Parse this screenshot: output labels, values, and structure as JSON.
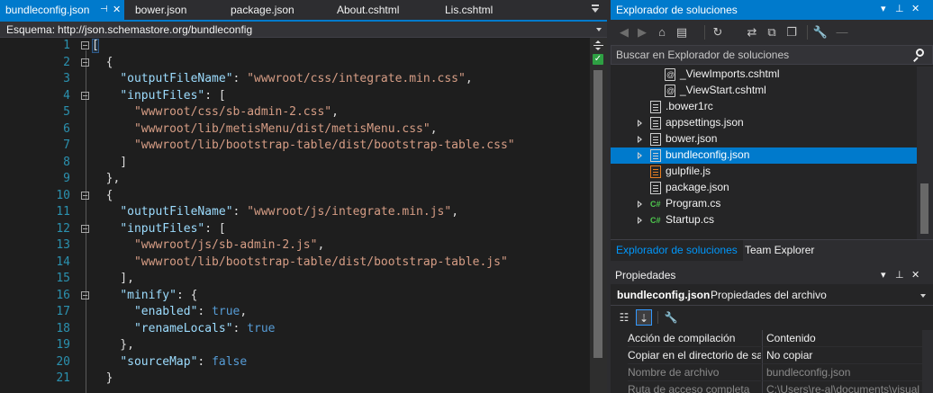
{
  "editor": {
    "tabs": [
      {
        "label": "bundleconfig.json",
        "active": true
      },
      {
        "label": "bower.json",
        "active": false
      },
      {
        "label": "package.json",
        "active": false
      },
      {
        "label": "About.cshtml",
        "active": false
      },
      {
        "label": "Lis.cshtml",
        "active": false
      }
    ],
    "pin_icon": "pin-icon",
    "close_icon": "close-icon",
    "schema_label": "Esquema:",
    "schema_value": "http://json.schemastore.org/bundleconfig",
    "lines": [
      {
        "n": "1",
        "fold": true,
        "tokens": [
          [
            "p",
            "["
          ]
        ]
      },
      {
        "n": "2",
        "fold": true,
        "tokens": [
          [
            "p",
            "  {"
          ]
        ]
      },
      {
        "n": "3",
        "fold": false,
        "tokens": [
          [
            "p",
            "    "
          ],
          [
            "k",
            "\"outputFileName\""
          ],
          [
            "p",
            ": "
          ],
          [
            "s",
            "\"wwwroot/css/integrate.min.css\""
          ],
          [
            "p",
            ","
          ]
        ]
      },
      {
        "n": "4",
        "fold": true,
        "tokens": [
          [
            "p",
            "    "
          ],
          [
            "k",
            "\"inputFiles\""
          ],
          [
            "p",
            ": ["
          ]
        ]
      },
      {
        "n": "5",
        "fold": false,
        "tokens": [
          [
            "p",
            "      "
          ],
          [
            "s",
            "\"wwwroot/css/sb-admin-2.css\""
          ],
          [
            "p",
            ","
          ]
        ]
      },
      {
        "n": "6",
        "fold": false,
        "tokens": [
          [
            "p",
            "      "
          ],
          [
            "s",
            "\"wwwroot/lib/metisMenu/dist/metisMenu.css\""
          ],
          [
            "p",
            ","
          ]
        ]
      },
      {
        "n": "7",
        "fold": false,
        "tokens": [
          [
            "p",
            "      "
          ],
          [
            "s",
            "\"wwwroot/lib/bootstrap-table/dist/bootstrap-table.css\""
          ]
        ]
      },
      {
        "n": "8",
        "fold": false,
        "tokens": [
          [
            "p",
            "    ]"
          ]
        ]
      },
      {
        "n": "9",
        "fold": false,
        "tokens": [
          [
            "p",
            "  },"
          ]
        ]
      },
      {
        "n": "10",
        "fold": true,
        "tokens": [
          [
            "p",
            "  {"
          ]
        ]
      },
      {
        "n": "11",
        "fold": false,
        "tokens": [
          [
            "p",
            "    "
          ],
          [
            "k",
            "\"outputFileName\""
          ],
          [
            "p",
            ": "
          ],
          [
            "s",
            "\"wwwroot/js/integrate.min.js\""
          ],
          [
            "p",
            ","
          ]
        ]
      },
      {
        "n": "12",
        "fold": true,
        "tokens": [
          [
            "p",
            "    "
          ],
          [
            "k",
            "\"inputFiles\""
          ],
          [
            "p",
            ": ["
          ]
        ]
      },
      {
        "n": "13",
        "fold": false,
        "tokens": [
          [
            "p",
            "      "
          ],
          [
            "s",
            "\"wwwroot/js/sb-admin-2.js\""
          ],
          [
            "p",
            ","
          ]
        ]
      },
      {
        "n": "14",
        "fold": false,
        "tokens": [
          [
            "p",
            "      "
          ],
          [
            "s",
            "\"wwwroot/lib/bootstrap-table/dist/bootstrap-table.js\""
          ]
        ]
      },
      {
        "n": "15",
        "fold": false,
        "tokens": [
          [
            "p",
            "    ],"
          ]
        ]
      },
      {
        "n": "16",
        "fold": true,
        "tokens": [
          [
            "p",
            "    "
          ],
          [
            "k",
            "\"minify\""
          ],
          [
            "p",
            ": {"
          ]
        ]
      },
      {
        "n": "17",
        "fold": false,
        "tokens": [
          [
            "p",
            "      "
          ],
          [
            "k",
            "\"enabled\""
          ],
          [
            "p",
            ": "
          ],
          [
            "b",
            "true"
          ],
          [
            "p",
            ","
          ]
        ]
      },
      {
        "n": "18",
        "fold": false,
        "tokens": [
          [
            "p",
            "      "
          ],
          [
            "k",
            "\"renameLocals\""
          ],
          [
            "p",
            ": "
          ],
          [
            "b",
            "true"
          ]
        ]
      },
      {
        "n": "19",
        "fold": false,
        "tokens": [
          [
            "p",
            "    },"
          ]
        ]
      },
      {
        "n": "20",
        "fold": false,
        "tokens": [
          [
            "p",
            "    "
          ],
          [
            "k",
            "\"sourceMap\""
          ],
          [
            "p",
            ": "
          ],
          [
            "b",
            "false"
          ]
        ]
      },
      {
        "n": "21",
        "fold": false,
        "tokens": [
          [
            "p",
            "  }"
          ]
        ]
      }
    ],
    "ok_mark": "✓"
  },
  "solution_explorer": {
    "title": "Explorador de soluciones",
    "search_placeholder": "Buscar en Explorador de soluciones",
    "toolbar_icons": [
      "back-icon",
      "forward-icon",
      "home-icon",
      "switch-views-icon",
      "history-icon",
      "sync-icon",
      "collapse-icon",
      "copy-icon",
      "properties-icon",
      "preview-icon"
    ],
    "items": [
      {
        "label": "_ViewImports.cshtml",
        "icon": "razor",
        "arrow": false,
        "selected": false
      },
      {
        "label": "_ViewStart.cshtml",
        "icon": "razor",
        "arrow": false,
        "selected": false
      },
      {
        "label": ".bower1rc",
        "icon": "doc",
        "arrow": false,
        "selected": false
      },
      {
        "label": "appsettings.json",
        "icon": "doc",
        "arrow": true,
        "selected": false
      },
      {
        "label": "bower.json",
        "icon": "doc",
        "arrow": true,
        "selected": false
      },
      {
        "label": "bundleconfig.json",
        "icon": "doc",
        "arrow": true,
        "selected": true
      },
      {
        "label": "gulpfile.js",
        "icon": "js",
        "arrow": false,
        "selected": false
      },
      {
        "label": "package.json",
        "icon": "doc",
        "arrow": false,
        "selected": false
      },
      {
        "label": "Program.cs",
        "icon": "cs",
        "arrow": true,
        "selected": false
      },
      {
        "label": "Startup.cs",
        "icon": "cs",
        "arrow": true,
        "selected": false
      }
    ],
    "tabs": [
      {
        "label": "Explorador de soluciones",
        "active": true
      },
      {
        "label": "Team Explorer",
        "active": false
      }
    ]
  },
  "properties": {
    "title": "Propiedades",
    "object_name": "bundleconfig.json",
    "object_type": "Propiedades del archivo",
    "rows": [
      {
        "name": "Acción de compilación",
        "value": "Contenido",
        "readonly": false
      },
      {
        "name": "Copiar en el directorio de sa",
        "value": "No copiar",
        "readonly": false
      },
      {
        "name": "Nombre de archivo",
        "value": "bundleconfig.json",
        "readonly": true
      },
      {
        "name": "Ruta de acceso completa",
        "value": "C:\\Users\\re-al\\documents\\visual",
        "readonly": true
      }
    ]
  },
  "colors": {
    "accent": "#007acc",
    "editor_bg": "#1e1e1e",
    "json_key": "#9cdcfe",
    "json_string": "#d69d85",
    "json_keyword": "#569cd6",
    "line_number": "#2b91af"
  }
}
